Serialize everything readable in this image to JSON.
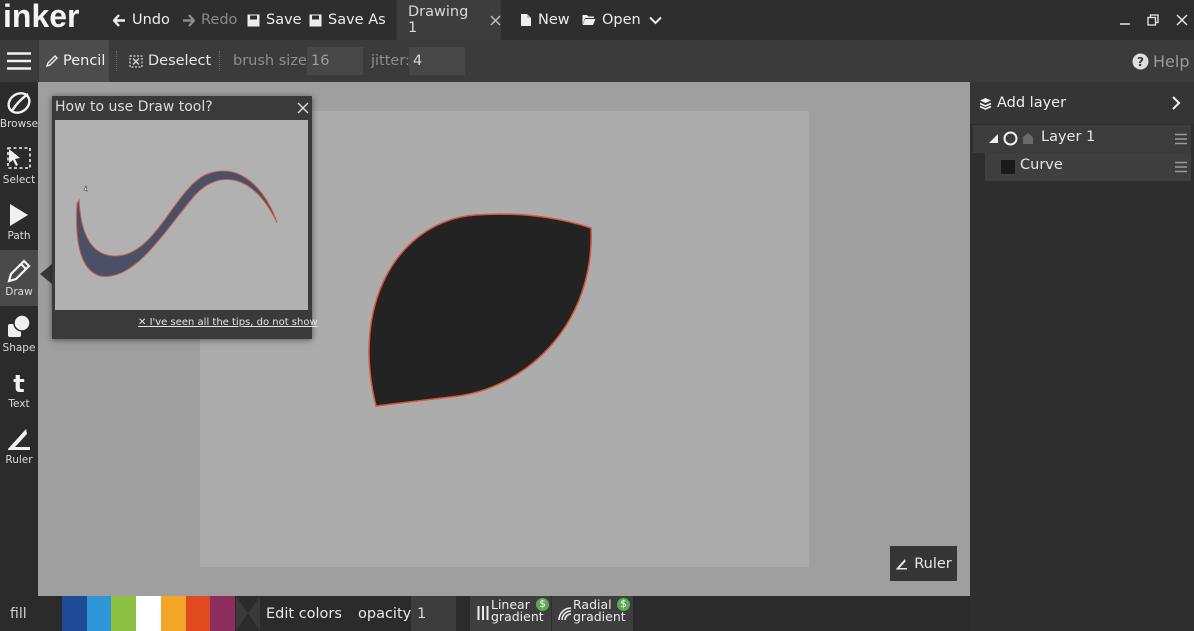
{
  "app": {
    "logo_text": "inker"
  },
  "titlebar": {
    "undo": "Undo",
    "redo": "Redo",
    "save": "Save",
    "save_as": "Save As",
    "tab_title": "Drawing 1",
    "new": "New",
    "open": "Open"
  },
  "options": {
    "tool_name": "Pencil",
    "deselect": "Deselect",
    "brush_size_label": "brush size:",
    "brush_size_value": "16",
    "jitter_label": "jitter:",
    "jitter_value": "4",
    "help": "Help"
  },
  "tools": [
    {
      "label": "Browse",
      "icon": "browse-icon"
    },
    {
      "label": "Select",
      "icon": "select-icon"
    },
    {
      "label": "Path",
      "icon": "path-icon"
    },
    {
      "label": "Draw",
      "icon": "draw-icon",
      "active": true
    },
    {
      "label": "Shape",
      "icon": "shape-icon"
    },
    {
      "label": "Text",
      "icon": "text-icon"
    },
    {
      "label": "Ruler",
      "icon": "ruler-icon"
    }
  ],
  "tip": {
    "title": "How to use Draw tool?",
    "dismiss": "I've seen all the tips, do not show"
  },
  "canvas": {
    "ruler_button": "Ruler",
    "shape_fill": "#232323",
    "shape_stroke": "#d9533a"
  },
  "layers": {
    "add_layer": "Add layer",
    "items": [
      {
        "name": "Layer 1"
      },
      {
        "name": "Curve"
      }
    ]
  },
  "bottom": {
    "fill_label": "fill",
    "swatches": [
      "#1e4a96",
      "#2f96d8",
      "#8bc040",
      "#ffffff",
      "#f2a527",
      "#e04a1e",
      "#8c2d5e"
    ],
    "edit_colors": "Edit colors",
    "opacity_label": "opacity:",
    "opacity_value": "1",
    "linear_gradient": [
      "Linear",
      "gradient"
    ],
    "radial_gradient": [
      "Radial",
      "gradient"
    ],
    "premium_badge": "$"
  }
}
